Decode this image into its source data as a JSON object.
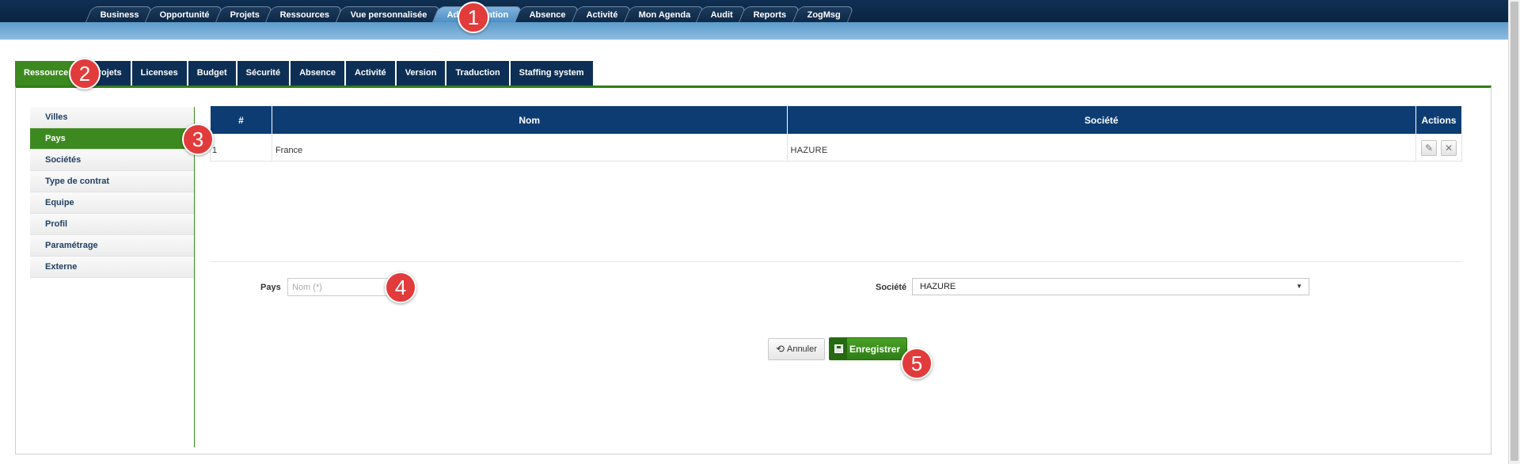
{
  "top_nav": {
    "tabs": [
      "Business",
      "Opportunité",
      "Projets",
      "Ressources",
      "Vue personnalisée",
      "Administration",
      "Absence",
      "Activité",
      "Mon Agenda",
      "Audit",
      "Reports",
      "ZogMsg"
    ],
    "active": "Administration"
  },
  "sub_nav": {
    "tabs": [
      "Ressources",
      "Projets",
      "Licenses",
      "Budget",
      "Sécurité",
      "Absence",
      "Activité",
      "Version",
      "Traduction",
      "Staffing system"
    ],
    "active": "Ressources"
  },
  "sidebar": {
    "items": [
      "Villes",
      "Pays",
      "Sociétés",
      "Type de contrat",
      "Equipe",
      "Profil",
      "Paramétrage",
      "Externe"
    ],
    "active": "Pays"
  },
  "table": {
    "columns": [
      "#",
      "Nom",
      "Société",
      "Actions"
    ],
    "rows": [
      {
        "num": "1",
        "nom": "France",
        "societe": "HAZURE"
      }
    ],
    "actions": {
      "edit_icon": "pencil-icon",
      "delete_icon": "close-icon"
    }
  },
  "form": {
    "pays_label": "Pays",
    "nom_placeholder": "Nom (*)",
    "societe_label": "Société",
    "societe_value": "HAZURE",
    "cancel_label": "Annuler",
    "save_label": "Enregistrer"
  },
  "markers": [
    "1",
    "2",
    "3",
    "4",
    "5"
  ],
  "colors": {
    "nav_dark": "#0d2f55",
    "accent_green": "#3c8a1f",
    "table_header": "#0d3c73",
    "marker_red": "#e23b3b"
  }
}
